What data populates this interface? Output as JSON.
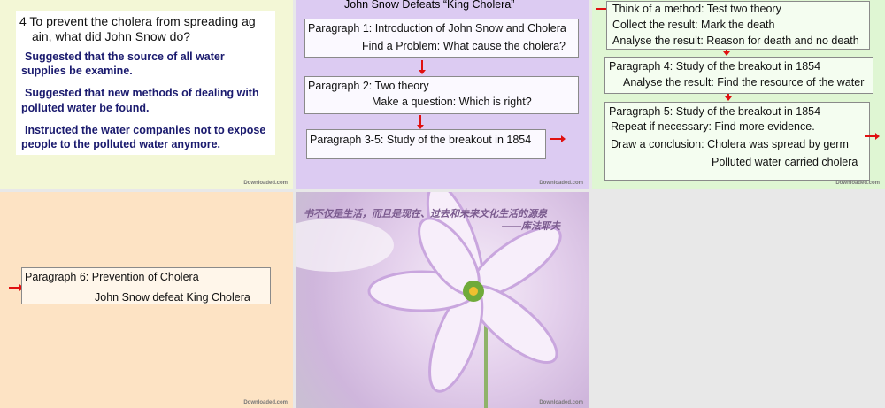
{
  "slides": [
    {
      "question": [
        "4 To prevent the cholera from spreading ag",
        "ain, what did John Snow do?"
      ],
      "answers": [
        [
          "Suggested that the source of all water",
          "supplies be examine."
        ],
        [
          "Suggested that new methods of dealing with",
          "polluted water be found."
        ],
        [
          "Instructed the water companies not to expose",
          "people to the polluted water anymore."
        ]
      ]
    },
    {
      "title": "John Snow Defeats “King Cholera”",
      "box1": [
        "Paragraph 1: Introduction of John Snow and Cholera",
        "Find a Problem: What cause the cholera?"
      ],
      "box2": [
        "Paragraph 2: Two theory",
        "Make a question: Which is right?"
      ],
      "box3": "Paragraph 3-5: Study of the breakout in 1854"
    },
    {
      "box1": [
        "Think of a method: Test two theory",
        "Collect  the result: Mark the death",
        "Analyse the result: Reason for death and no death"
      ],
      "box2": [
        "Paragraph 4: Study of the breakout in 1854",
        "Analyse the result: Find the resource of the water"
      ],
      "box3": [
        "Paragraph 5: Study of the breakout in 1854",
        "Repeat if necessary: Find more evidence.",
        "Draw a conclusion: Cholera was spread by germ",
        "Polluted water carried cholera"
      ]
    },
    {
      "box": [
        "Paragraph 6: Prevention of Cholera",
        "John Snow defeat King Cholera"
      ]
    },
    {
      "quote": "书不仅是生活，而且是现在、过去和未来文化生活的源泉",
      "author": "——库法耶夫"
    }
  ],
  "watermark": "Downloaded.com"
}
